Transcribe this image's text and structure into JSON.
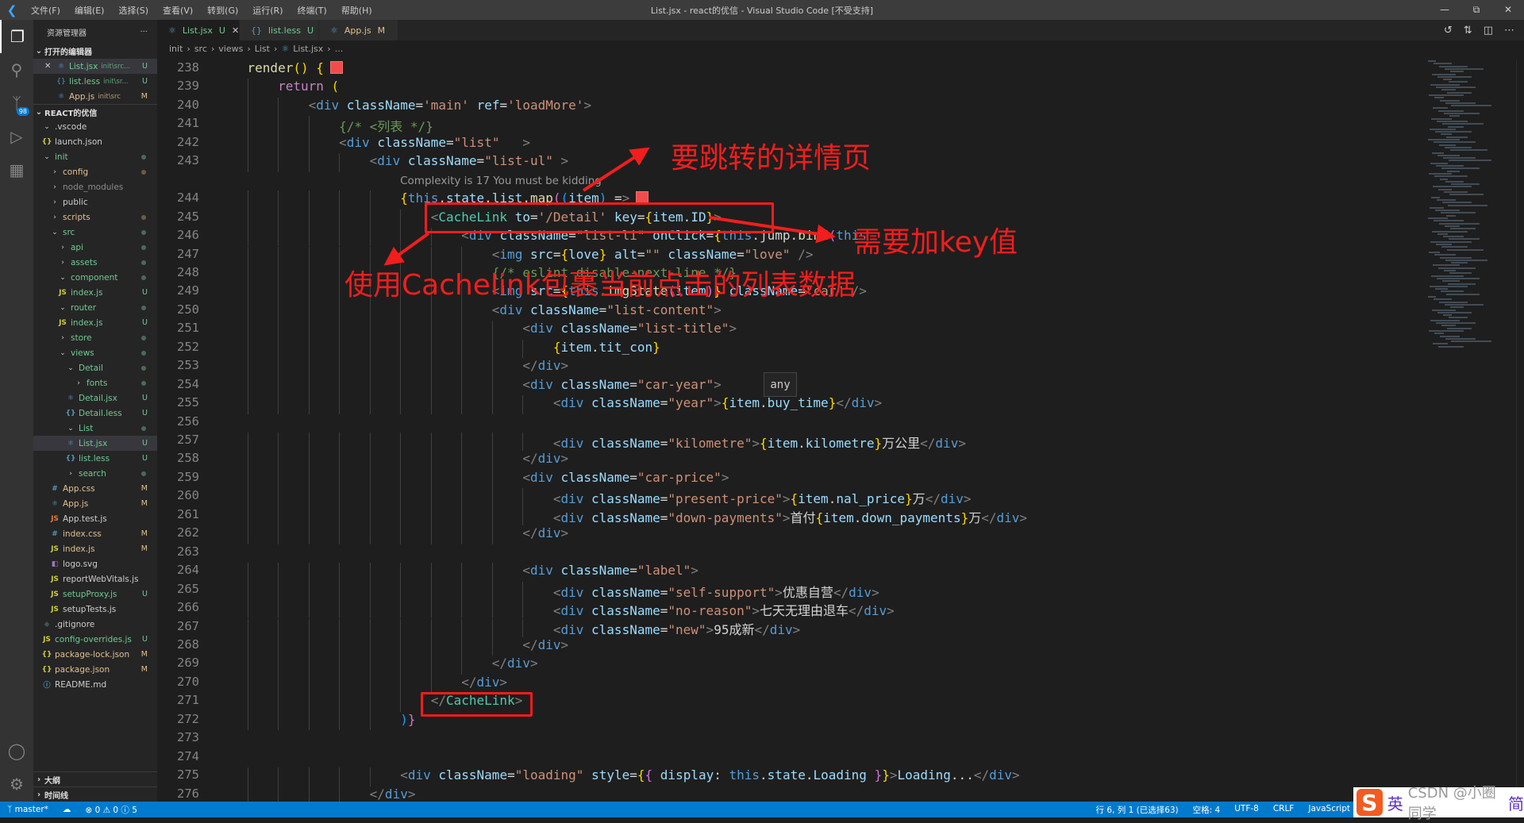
{
  "titlebar": {
    "menus": [
      "文件(F)",
      "编辑(E)",
      "选择(S)",
      "查看(V)",
      "转到(G)",
      "运行(R)",
      "终端(T)",
      "帮助(H)"
    ],
    "title": "List.jsx - react的优信 - Visual Studio Code [不受支持]"
  },
  "activity": {
    "scm_badge": "98"
  },
  "sidebar": {
    "header": "资源管理器",
    "more": "···",
    "open_editors_title": "打开的编辑器",
    "open_editors": [
      {
        "name": "List.jsx",
        "desc": "init\\src...",
        "status": "U",
        "icon": "react-icon"
      },
      {
        "name": "list.less",
        "desc": "init\\sr...",
        "status": "U",
        "icon": "braces-icon"
      },
      {
        "name": "App.js",
        "desc": "init\\src",
        "status": "M",
        "icon": "react-icon"
      }
    ],
    "project_title": "REACT的优信",
    "tree": [
      {
        "name": ".vscode",
        "depth": 1,
        "type": "open",
        "color": "white"
      },
      {
        "name": "launch.json",
        "depth": 1,
        "type": "json",
        "color": "white"
      },
      {
        "name": "init",
        "depth": 1,
        "type": "open",
        "color": "green",
        "dot": "#4b6b55"
      },
      {
        "name": "config",
        "depth": 2,
        "type": "closed",
        "color": "orange",
        "dot": "#6d5a45"
      },
      {
        "name": "node_modules",
        "depth": 2,
        "type": "closed",
        "color": "gray"
      },
      {
        "name": "public",
        "depth": 2,
        "type": "closed",
        "color": "white"
      },
      {
        "name": "scripts",
        "depth": 2,
        "type": "closed",
        "color": "orange",
        "dot": "#6d5a45"
      },
      {
        "name": "src",
        "depth": 2,
        "type": "open",
        "color": "green",
        "dot": "#4b6b55"
      },
      {
        "name": "api",
        "depth": 3,
        "type": "closed",
        "color": "green",
        "dot": "#4b6b55"
      },
      {
        "name": "assets",
        "depth": 3,
        "type": "closed",
        "color": "green",
        "dot": "#4b6b55"
      },
      {
        "name": "component",
        "depth": 3,
        "type": "open",
        "color": "green",
        "dot": "#4b6b55"
      },
      {
        "name": "index.js",
        "depth": 3,
        "type": "js",
        "color": "green",
        "status": "U"
      },
      {
        "name": "router",
        "depth": 3,
        "type": "open",
        "color": "green",
        "dot": "#4b6b55"
      },
      {
        "name": "index.js",
        "depth": 3,
        "type": "js",
        "color": "green",
        "status": "U"
      },
      {
        "name": "store",
        "depth": 3,
        "type": "closed",
        "color": "green",
        "dot": "#4b6b55"
      },
      {
        "name": "views",
        "depth": 3,
        "type": "open",
        "color": "green",
        "dot": "#4b6b55"
      },
      {
        "name": "Detail",
        "depth": 4,
        "type": "open",
        "color": "green",
        "dot": "#4b6b55"
      },
      {
        "name": "fonts",
        "depth": 5,
        "type": "closed",
        "color": "green",
        "dot": "#4b6b55"
      },
      {
        "name": "Detail.jsx",
        "depth": 4,
        "type": "react",
        "color": "green",
        "status": "U"
      },
      {
        "name": "Detail.less",
        "depth": 4,
        "type": "less",
        "color": "green",
        "status": "U"
      },
      {
        "name": "List",
        "depth": 4,
        "type": "open",
        "color": "green",
        "dot": "#4b6b55"
      },
      {
        "name": "List.jsx",
        "depth": 4,
        "type": "react",
        "color": "green",
        "status": "U",
        "selected": true
      },
      {
        "name": "list.less",
        "depth": 4,
        "type": "less",
        "color": "green",
        "status": "U"
      },
      {
        "name": "search",
        "depth": 4,
        "type": "closed",
        "color": "green",
        "dot": "#4b6b55"
      },
      {
        "name": "App.css",
        "depth": 2,
        "type": "css",
        "color": "orange",
        "status": "M"
      },
      {
        "name": "App.js",
        "depth": 2,
        "type": "react",
        "color": "orange",
        "status": "M"
      },
      {
        "name": "App.test.js",
        "depth": 2,
        "type": "jstest",
        "color": "white"
      },
      {
        "name": "index.css",
        "depth": 2,
        "type": "css",
        "color": "orange",
        "status": "M"
      },
      {
        "name": "index.js",
        "depth": 2,
        "type": "js",
        "color": "orange",
        "status": "M"
      },
      {
        "name": "logo.svg",
        "depth": 2,
        "type": "svg",
        "color": "white"
      },
      {
        "name": "reportWebVitals.js",
        "depth": 2,
        "type": "js",
        "color": "white"
      },
      {
        "name": "setupProxy.js",
        "depth": 2,
        "type": "js",
        "color": "green",
        "status": "U"
      },
      {
        "name": "setupTests.js",
        "depth": 2,
        "type": "js",
        "color": "white"
      },
      {
        "name": ".gitignore",
        "depth": 1,
        "type": "git",
        "color": "white"
      },
      {
        "name": "config-overrides.js",
        "depth": 1,
        "type": "js",
        "color": "green",
        "status": "U"
      },
      {
        "name": "package-lock.json",
        "depth": 1,
        "type": "json",
        "color": "orange",
        "status": "M"
      },
      {
        "name": "package.json",
        "depth": 1,
        "type": "json",
        "color": "orange",
        "status": "M"
      },
      {
        "name": "README.md",
        "depth": 1,
        "type": "info",
        "color": "white"
      }
    ],
    "outline": "大纲",
    "timeline": "时间线"
  },
  "tabs": [
    {
      "name": "List.jsx",
      "status": "U",
      "active": true,
      "color": "#73c991"
    },
    {
      "name": "list.less",
      "status": "U",
      "active": false,
      "color": "#73c991"
    },
    {
      "name": "App.js",
      "status": "M",
      "active": false,
      "color": "#e2c08d"
    }
  ],
  "breadcrumb": [
    "init",
    "src",
    "views",
    "List",
    "List.jsx",
    "..."
  ],
  "editor": {
    "first_line": 238,
    "codelens_before": 244,
    "codelens": "Complexity is 17 You must be kidding",
    "markers_on": [
      238,
      244
    ],
    "lines": [
      "    render() {",
      "        return (",
      "            <div className='main' ref='loadMore'>",
      "                {/* <列表 */}",
      "                <div className=\"list\"   >",
      "                    <div className=\"list-ul\" >",
      "                        {this.state.list.map((item) =>",
      "                            <CacheLink to='/Detail' key={item.ID}>",
      "                                <div className=\"list-li\" onClick={this.jump.bind(this",
      "                                    <img src={love} alt=\"\" className=\"love\" />",
      "                                    {/* eslint-disable-next-line */}",
      "                                    <img src={this.imgState(item)} className=\"car\" />",
      "                                    <div className=\"list-content\">",
      "                                        <div className=\"list-title\">",
      "                                            {item.tit_con}",
      "                                        </div>",
      "                                        <div className=\"car-year\">",
      "                                            <div className=\"year\">{item.buy_time}</div>",
      "",
      "                                            <div className=\"kilometre\">{item.kilometre}万公里</div>",
      "                                        </div>",
      "                                        <div className=\"car-price\">",
      "                                            <div className=\"present-price\">{item.nal_price}万</div>",
      "                                            <div className=\"down-payments\">首付{item.down_payments}万</div>",
      "                                        </div>",
      "",
      "                                        <div className=\"label\">",
      "                                            <div className=\"self-support\">优惠自营</div>",
      "                                            <div className=\"no-reason\">七天无理由退车</div>",
      "                                            <div className=\"new\">95成新</div>",
      "                                        </div>",
      "                                    </div>",
      "                                </div>",
      "                            </CacheLink>",
      "                        )}",
      "",
      "",
      "                        <div className=\"loading\" style={{ display: this.state.Loading }}>Loading...</div>",
      "                    </div>"
    ],
    "hover_tooltip": "any"
  },
  "annotations": {
    "color": "#f21d1d",
    "detail_page": "要跳转的详情页",
    "need_key": "需要加key值",
    "wrap_with_cachelink": "使用Cachelink包裹当前点击的列表数据"
  },
  "statusbar": {
    "branch": "master*",
    "errors": "0",
    "warnings": "0",
    "infos": "5",
    "position": "行 6, 列 1 (已选择63)",
    "spaces": "空格: 4",
    "encoding": "UTF-8",
    "eol": "CRLF",
    "language": "JavaScript",
    "color": "#007acc"
  },
  "ime": {
    "logo": "S",
    "items": [
      "英",
      "CSDN @小圈同学",
      "简"
    ]
  }
}
